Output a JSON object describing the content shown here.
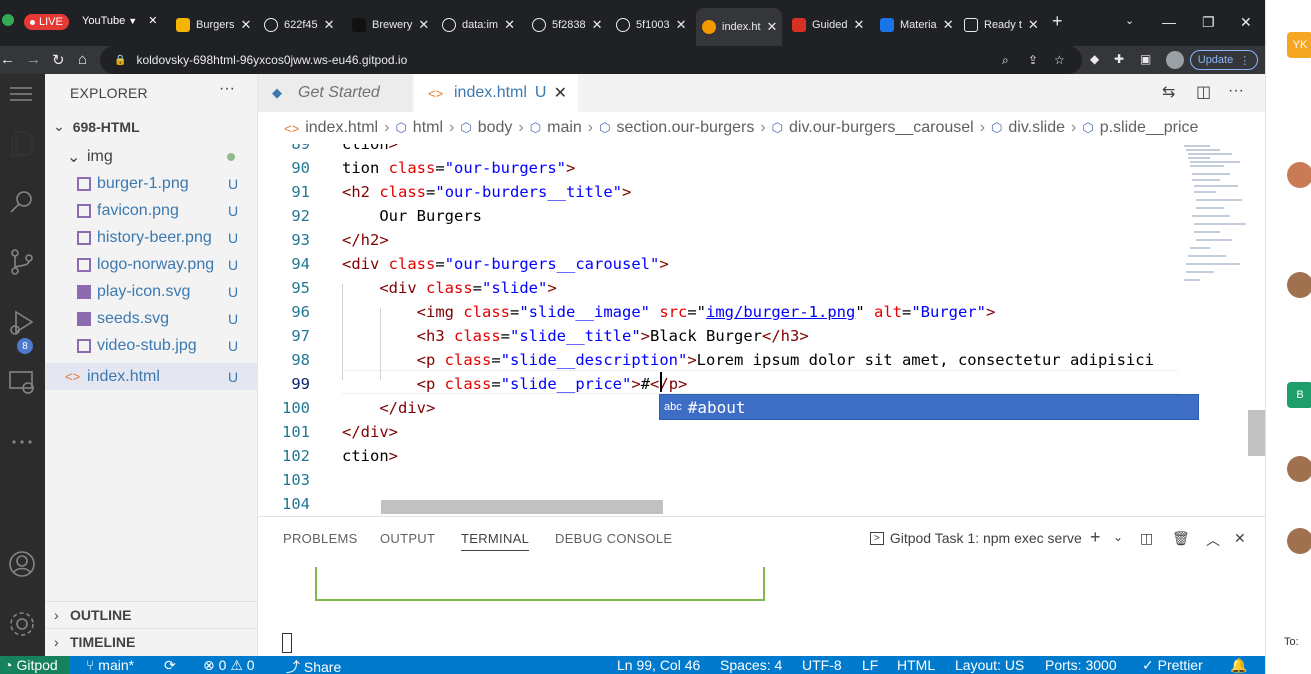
{
  "browser": {
    "tabs": [
      {
        "label": "LIVE",
        "kind": "live"
      },
      {
        "label": "YouTube",
        "kind": "yt"
      },
      {
        "label": "Burgers",
        "color": "#f4b400"
      },
      {
        "label": "622f45",
        "color": "#e8eaed"
      },
      {
        "label": "Brewery",
        "color": "#111111"
      },
      {
        "label": "data:im",
        "color": "#e8eaed"
      },
      {
        "label": "5f2838",
        "color": "#e8eaed"
      },
      {
        "label": "5f1003",
        "color": "#e8eaed"
      },
      {
        "label": "index.ht",
        "color": "#f29900",
        "active": true
      },
      {
        "label": "Guided",
        "color": "#d93025"
      },
      {
        "label": "Materia",
        "color": "#1a73e8"
      },
      {
        "label": "Ready t",
        "color": "#e8eaed"
      }
    ],
    "url": "koldovsky-698html-96yxcos0jww.ws-eu46.gitpod.io",
    "update_label": "Update"
  },
  "right_strip": {
    "avatars": [
      {
        "label": "YK",
        "color": "#f5a623"
      },
      {
        "label": "B",
        "color": "#1e9e6a"
      }
    ],
    "to_label": "To:"
  },
  "activity": {
    "scm_badge": "8"
  },
  "explorer": {
    "title": "EXPLORER",
    "folder": "698-HTML",
    "subfolder": "img",
    "files": [
      {
        "name": "burger-1.png",
        "status": "U",
        "type": "image"
      },
      {
        "name": "favicon.png",
        "status": "U",
        "type": "image"
      },
      {
        "name": "history-beer.png",
        "status": "U",
        "type": "image"
      },
      {
        "name": "logo-norway.png",
        "status": "U",
        "type": "image"
      },
      {
        "name": "play-icon.svg",
        "status": "U",
        "type": "svg"
      },
      {
        "name": "seeds.svg",
        "status": "U",
        "type": "svg"
      },
      {
        "name": "video-stub.jpg",
        "status": "U",
        "type": "image"
      },
      {
        "name": "index.html",
        "status": "U",
        "type": "html"
      }
    ],
    "outline": "OUTLINE",
    "timeline": "TIMELINE"
  },
  "editor_tabs": {
    "inactive": "Get Started",
    "active": "index.html",
    "active_status": "U"
  },
  "breadcrumb": [
    "index.html",
    "html",
    "body",
    "main",
    "section.our-burgers",
    "div.our-burgers__carousel",
    "div.slide",
    "p.slide__price"
  ],
  "code_lines": [
    {
      "num": "89",
      "text": "ction>"
    },
    {
      "num": "90",
      "text": "tion class=\"our-burgers\">"
    },
    {
      "num": "91",
      "text": "<h2 class=\"our-burders__title\">"
    },
    {
      "num": "92",
      "text": "    Our Burgers"
    },
    {
      "num": "93",
      "text": "</h2>"
    },
    {
      "num": "94",
      "text": "<div class=\"our-burgers__carousel\">"
    },
    {
      "num": "95",
      "text": "    <div class=\"slide\">"
    },
    {
      "num": "96",
      "text": "        <img class=\"slide__image\" src=\"img/burger-1.png\" alt=\"Burger\">"
    },
    {
      "num": "97",
      "text": "        <h3 class=\"slide__title\">Black Burger</h3>"
    },
    {
      "num": "98",
      "text": "        <p class=\"slide__description\">Lorem ipsum dolor sit amet, consectetur adipisici"
    },
    {
      "num": "99",
      "text": "        <p class=\"slide__price\">#</p>"
    },
    {
      "num": "100",
      "text": "    </div>"
    },
    {
      "num": "101",
      "text": "</div>"
    },
    {
      "num": "102",
      "text": "ction>"
    },
    {
      "num": "103",
      "text": ""
    },
    {
      "num": "104",
      "text": ""
    }
  ],
  "suggestion": {
    "kind": "abc",
    "text": "#about"
  },
  "panel": {
    "tabs": [
      "PROBLEMS",
      "OUTPUT",
      "TERMINAL",
      "DEBUG CONSOLE"
    ],
    "active_tab": "TERMINAL",
    "terminal_name": "Gitpod Task 1: npm exec serve"
  },
  "status": {
    "gitpod": "Gitpod",
    "branch": "main*",
    "errors": "0",
    "warnings": "0",
    "share": "Share",
    "position": "Ln 99, Col 46",
    "spaces": "Spaces: 4",
    "encoding": "UTF-8",
    "eol": "LF",
    "language": "HTML",
    "layout": "Layout: US",
    "ports": "Ports: 3000",
    "prettier": "Prettier"
  }
}
